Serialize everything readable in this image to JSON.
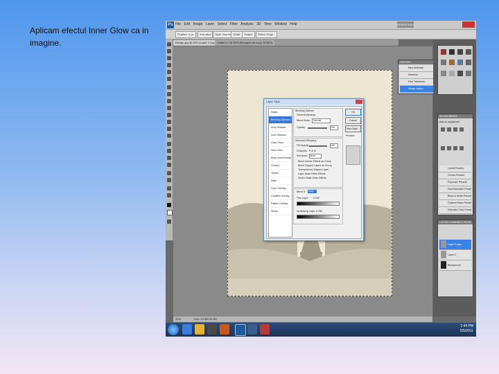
{
  "slide": {
    "caption": "Aplicam efectul Inner Glow ca in imagine."
  },
  "photoshop": {
    "menu_items": "File Edit Image Layer Select Filter Analysis 3D View Window Help",
    "logo": "Ps",
    "workspace_button": "ESSENTIALS",
    "options": [
      "Feather: 0 px",
      "Anti-alias",
      "Style: Normal",
      "Width:",
      "Height:",
      "Refine Edge..."
    ],
    "doc_tabs": [
      "Design.jpg @ 25% (Layer 0 copy, RGB/8*)",
      "Untitled-1 @ 50% (Background copy, RGB/8)"
    ],
    "status": {
      "zoom": "25%",
      "doc": "Doc: 20.9M/34.9M"
    }
  },
  "layer_style_dialog": {
    "title": "Layer Style",
    "styles": [
      "Styles",
      "Blending Options: Custom",
      "Drop Shadow",
      "Inner Shadow",
      "Outer Glow",
      "Inner Glow",
      "Bevel and Emboss",
      "Contour",
      "Texture",
      "Satin",
      "Color Overlay",
      "Gradient Overlay",
      "Pattern Overlay",
      "Stroke"
    ],
    "selected_style_index": 1,
    "group1_title": "Blending Options",
    "group1_sub": "General Blending",
    "blend_mode_label": "Blend Mode:",
    "blend_mode_value": "Normal",
    "opacity_label": "Opacity:",
    "opacity_value": "100",
    "group2_title": "Advanced Blending",
    "fill_opacity_label": "Fill Opacity:",
    "fill_opacity_value": "100",
    "channels_label": "Channels:",
    "channels": "R  G  B",
    "knockout_label": "Knockout:",
    "knockout_value": "None",
    "checks": [
      "Blend Interior Effects as Group",
      "Blend Clipped Layers as Group",
      "Transparency Shapes Layer",
      "Layer Mask Hides Effects",
      "Vector Mask Hides Effects"
    ],
    "blend_if_label": "Blend If:",
    "blend_if_value": "Gray",
    "this_layer_label": "This Layer:",
    "this_layer_values": "0    255",
    "underlying_label": "Underlying Layer:",
    "underlying_values": "0    255",
    "buttons": [
      "OK",
      "Cancel",
      "New Style...",
      "Preview"
    ]
  },
  "panels": {
    "history_title": "HISTORY",
    "history_items": [
      "New Selection",
      "Deselect",
      "Free Transform",
      "Merge Layers"
    ],
    "adjustments_title": "ADJUSTMENTS",
    "adjustments_sub": "Add an adjustment",
    "presets": [
      "Levels Presets",
      "Curves Presets",
      "Exposure Presets",
      "Hue/Saturation Presets",
      "Black & White Presets",
      "Channel Mixer Presets",
      "Selective Color Presets"
    ],
    "layers_tabs": "LAYERS  CHANNELS  PATHS",
    "layers": [
      "Layer 0 copy",
      "Layer 0",
      "Background"
    ],
    "selected_layer_index": 0
  },
  "taskbar": {
    "time": "1:44 PM",
    "date": "5/5/2011"
  },
  "colors": {
    "selection": "#3a78d6",
    "ps_blue": "#1f5a99"
  }
}
